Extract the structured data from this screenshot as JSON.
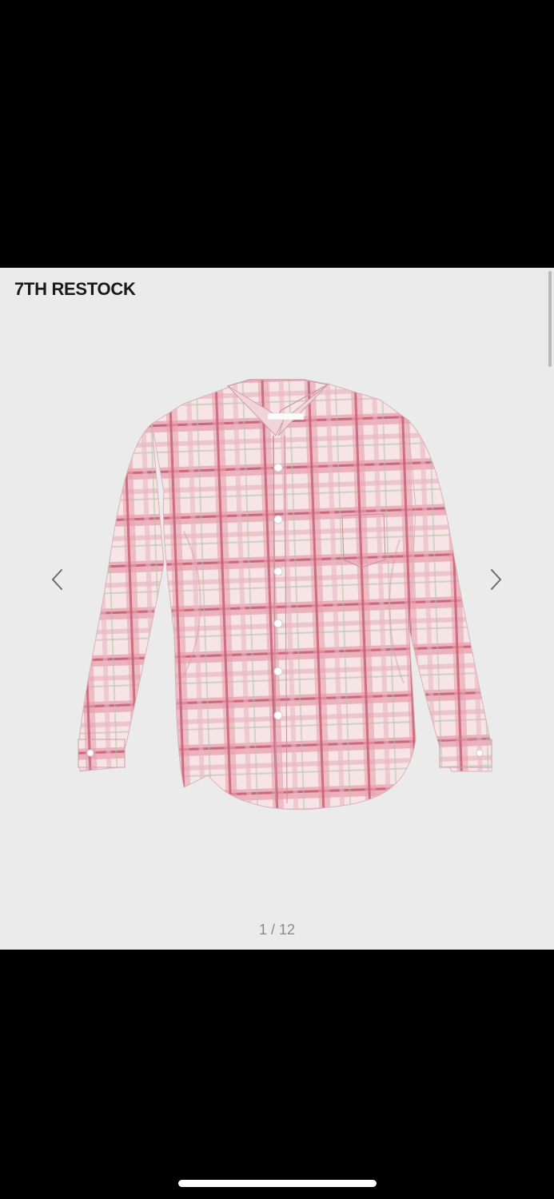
{
  "product": {
    "badge": "7TH RESTOCK",
    "image_description": "pink plaid long-sleeve button-up shirt",
    "colors": {
      "panel_background": "#ebebeb",
      "shirt_base": "#f3d4da",
      "shirt_check": "#d4697e",
      "letterbox": "#000000"
    }
  },
  "carousel": {
    "current": "1",
    "total": "12",
    "label": "1 / 12",
    "prev_icon": "chevron-left-icon",
    "next_icon": "chevron-right-icon"
  },
  "system": {
    "home_indicator": "home-indicator"
  }
}
